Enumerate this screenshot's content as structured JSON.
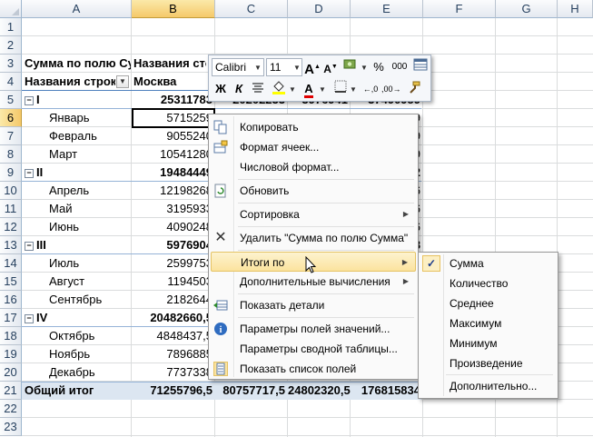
{
  "columns": [
    "A",
    "B",
    "C",
    "D",
    "E",
    "F",
    "G",
    "H"
  ],
  "rows": [
    "1",
    "2",
    "3",
    "4",
    "5",
    "6",
    "7",
    "8",
    "9",
    "10",
    "11",
    "12",
    "13",
    "14",
    "15",
    "16",
    "17",
    "18",
    "19",
    "20",
    "21",
    "22",
    "23"
  ],
  "pivot": {
    "r3_a": "Сумма по полю Сумма",
    "r3_b": "Названия столбцов",
    "r4_a": "Названия строк",
    "r4_b": "Москва",
    "r5_a": "I",
    "r5_b": "25311783",
    "r5_c": "20202233",
    "r5_d": "3976941",
    "r5_e": "37490959",
    "r6_a": "Январь",
    "r6_b": "5715259",
    "r6_e": "39",
    "r7_a": "Февраль",
    "r7_b": "9055240",
    "r7_e": "39",
    "r8_a": "Март",
    "r8_b": "10541280",
    "r8_e": "39",
    "r9_a": "II",
    "r9_b": "19484449",
    "r9_e": "02",
    "r10_a": "Апрель",
    "r10_b": "12198268",
    "r10_e": "26",
    "r11_a": "Май",
    "r11_b": "3195933",
    "r11_e": "26",
    "r12_a": "Июнь",
    "r12_b": "4090248",
    "r12_e": "26",
    "r13_a": "III",
    "r13_b": "5976904",
    "r13_e": "98",
    "r14_a": "Июль",
    "r14_b": "2599753",
    "r15_a": "Август",
    "r15_b": "1194503",
    "r16_a": "Сентябрь",
    "r16_b": "2182644",
    "r17_a": "IV",
    "r17_b": "20482660,5",
    "r18_a": "Октябрь",
    "r18_b": "4848437,5",
    "r19_a": "Ноябрь",
    "r19_b": "7896885",
    "r20_a": "Декабрь",
    "r20_b": "7737338",
    "r21_a": "Общий итог",
    "r21_b": "71255796,5",
    "r21_c": "80757717,5",
    "r21_d": "24802320,5",
    "r21_e": "176815834"
  },
  "mini_toolbar": {
    "font": "Calibri",
    "size": "11",
    "grow_font": "A",
    "shrink_font": "A",
    "percent": "%",
    "thousands": "000",
    "bold": "Ж",
    "italic": "К",
    "font_color_letter": "A"
  },
  "context_menu": {
    "items": [
      "Копировать",
      "Формат ячеек...",
      "Числовой формат...",
      "Обновить",
      "Сортировка",
      "Удалить \"Сумма по полю Сумма\"",
      "Итоги по",
      "Дополнительные вычисления",
      "Показать детали",
      "Параметры полей значений...",
      "Параметры сводной таблицы...",
      "Показать список полей"
    ]
  },
  "submenu": {
    "items": [
      "Сумма",
      "Количество",
      "Среднее",
      "Максимум",
      "Минимум",
      "Произведение",
      "Дополнительно..."
    ],
    "checked": "✓"
  },
  "colors": {
    "accent": "#f5c96a",
    "pivot_line": "#95b3d7",
    "total_fill": "#dce6f1"
  }
}
